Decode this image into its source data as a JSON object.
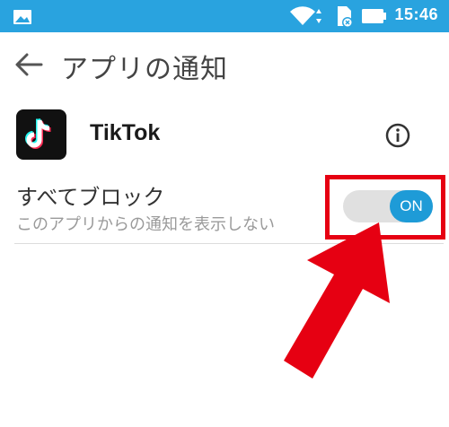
{
  "status_bar": {
    "time": "15:46",
    "icons": [
      "image-icon",
      "wifi-icon",
      "sd-card-icon",
      "battery-icon"
    ],
    "background": "#29a3df"
  },
  "app_bar": {
    "back_icon": "arrow-left-icon",
    "title": "アプリの通知"
  },
  "app": {
    "name": "TikTok",
    "icon": "tiktok-logo-icon",
    "info_icon": "info-icon"
  },
  "block_all": {
    "title": "すべてブロック",
    "subtitle": "このアプリからの通知を表示しない",
    "toggle_label": "ON",
    "toggle_on": true,
    "accent": "#1e9bd7"
  },
  "annotation": {
    "highlight_color": "#e60012"
  }
}
